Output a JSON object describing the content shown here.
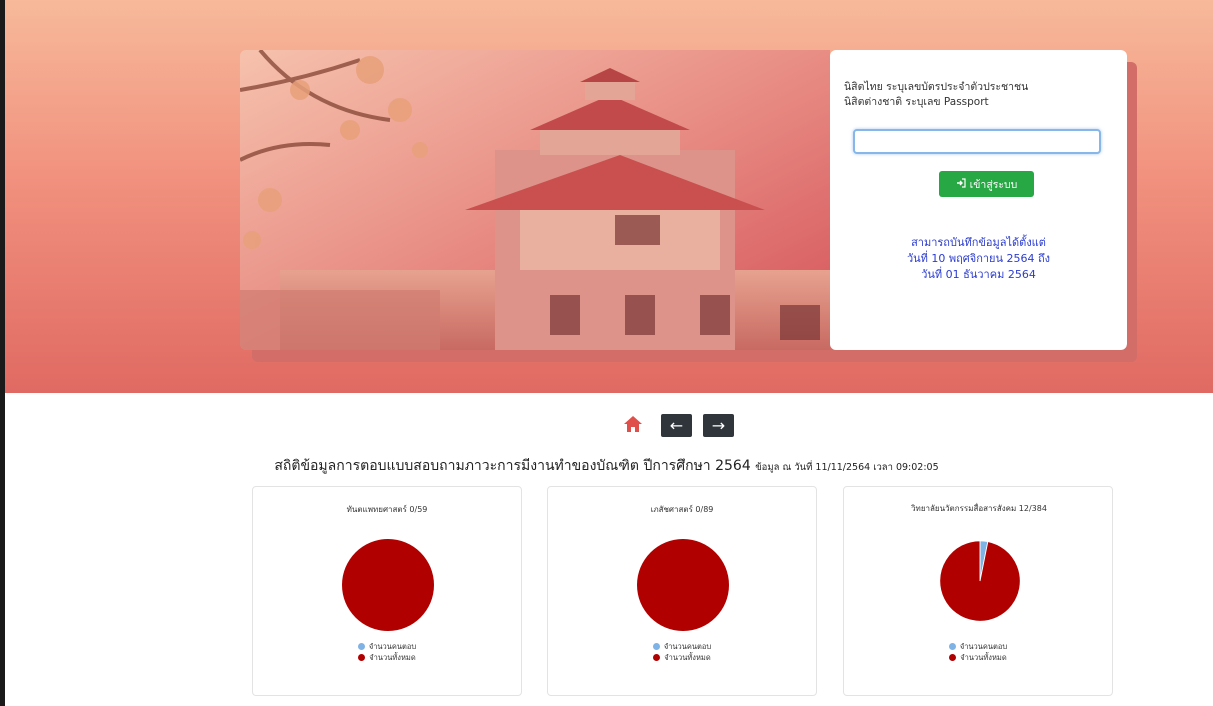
{
  "colors": {
    "answered": "#7fb2e5",
    "total": "#b00000",
    "login_button": "#28a745",
    "notice_text": "#2b3cd0"
  },
  "login": {
    "instruction_line1": "นิสิตไทย ระบุเลขบัตรประจำตัวประชาชน",
    "instruction_line2": "นิสิตต่างชาติ ระบุเลข Passport",
    "id_value": "",
    "button_icon": "sign-in-icon",
    "button_label": "เข้าสู่ระบบ",
    "notice_line1": "สามารถบันทึกข้อมูลได้ตั้งแต่",
    "notice_line2": "วันที่ 10 พฤศจิกายน 2564 ถึง",
    "notice_line3": "วันที่ 01 ธันวาคม 2564"
  },
  "nav": {
    "home_icon": "home-icon",
    "prev_icon": "arrow-left-icon",
    "next_icon": "arrow-right-icon",
    "prev_glyph": "←",
    "next_glyph": "→"
  },
  "stats": {
    "title": "สถิติข้อมูลการตอบแบบสอบถามภาวะการมีงานทำของบัณฑิต ปีการศึกษา 2564",
    "asof": "ข้อมูล ณ วันที่ 11/11/2564 เวลา 09:02:05"
  },
  "chart_data": [
    {
      "type": "pie",
      "title": "ทันตแพทยศาสตร์ 0/59",
      "categories": [
        "จำนวนคนตอบ",
        "จำนวนทั้งหมด"
      ],
      "values": [
        0,
        59
      ],
      "legend": "bottom"
    },
    {
      "type": "pie",
      "title": "เภสัชศาสตร์ 0/89",
      "categories": [
        "จำนวนคนตอบ",
        "จำนวนทั้งหมด"
      ],
      "values": [
        0,
        89
      ],
      "legend": "bottom"
    },
    {
      "type": "pie",
      "title": "วิทยาลัยนวัตกรรมสื่อสารสังคม 12/384",
      "categories": [
        "จำนวนคนตอบ",
        "จำนวนทั้งหมด"
      ],
      "values": [
        12,
        372
      ],
      "legend": "bottom"
    }
  ]
}
